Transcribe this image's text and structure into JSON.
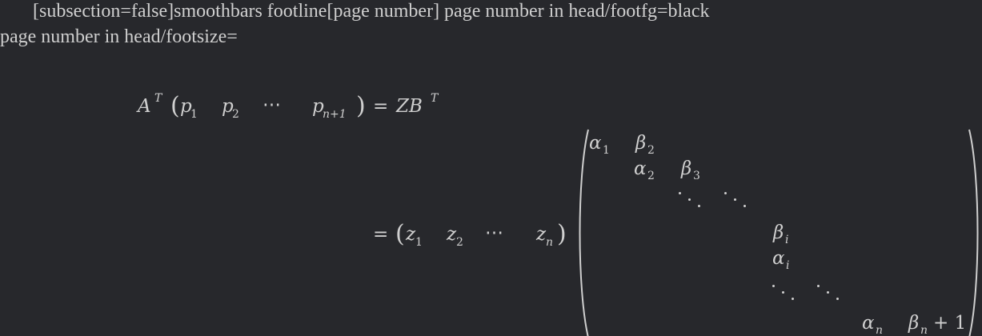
{
  "header": {
    "line1": "[subsection=false]smoothbars footline[page number] page number in head/footfg=black",
    "line2": "page number in head/footsize="
  },
  "equation": {
    "lhs": {
      "A": "A",
      "T": "T",
      "p": "p",
      "sub1": "1",
      "sub2": "2",
      "dots": "⋯",
      "subn1": "n+1"
    },
    "eq": "=",
    "ZB": "ZB",
    "T2": "T",
    "z": "z",
    "zsub1": "1",
    "zsub2": "2",
    "zsubn": "n",
    "matrix": {
      "alpha": "α",
      "beta": "β",
      "s1": "1",
      "s2": "2",
      "s3": "3",
      "si": "i",
      "sn": "n",
      "plus_one": "+ 1"
    }
  }
}
